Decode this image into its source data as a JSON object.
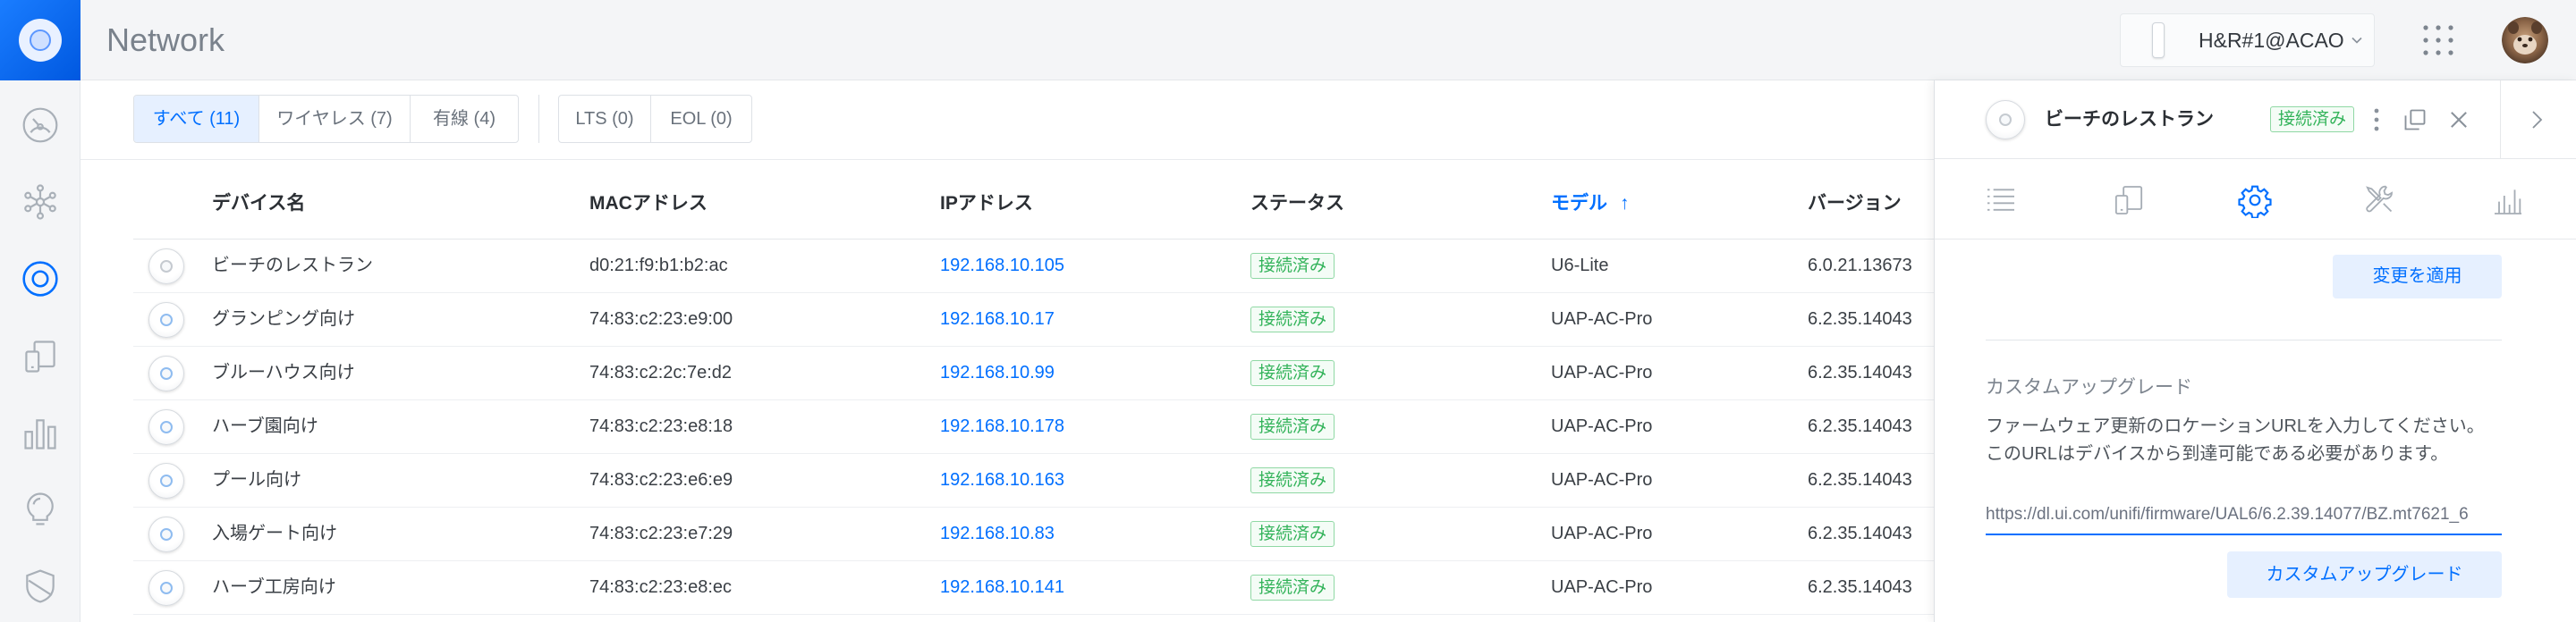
{
  "app": {
    "title": "Network"
  },
  "colors": {
    "accent": "#006fff",
    "connected": "#33b35a",
    "connected_border": "#8fd8a4",
    "muted_icon": "#a9b0b8"
  },
  "sidebar": {
    "logo": "unifi-logo",
    "items": [
      {
        "icon": "dashboard-icon",
        "active": false
      },
      {
        "icon": "topology-icon",
        "active": false
      },
      {
        "icon": "devices-icon",
        "active": true
      },
      {
        "icon": "clients-icon",
        "active": false
      },
      {
        "icon": "statistics-icon",
        "active": false
      },
      {
        "icon": "insights-icon",
        "active": false
      },
      {
        "icon": "shield-icon",
        "active": false
      }
    ]
  },
  "header": {
    "site_selector": {
      "label": "H&R#1@ACAO",
      "icon": "gateway-device-icon",
      "caret": "chevron-down-icon"
    },
    "apps_icon": "grid-icon",
    "avatar": "user-avatar"
  },
  "filters": {
    "device_type": [
      {
        "label": "すべて (11)",
        "active": true
      },
      {
        "label": "ワイヤレス (7)",
        "active": false
      },
      {
        "label": "有線 (4)",
        "active": false
      }
    ],
    "lifecycle": [
      {
        "label": "LTS (0)",
        "active": false
      },
      {
        "label": "EOL (0)",
        "active": false
      }
    ]
  },
  "table": {
    "columns": {
      "name": "デバイス名",
      "mac": "MACアドレス",
      "ip": "IPアドレス",
      "status": "ステータス",
      "model": "モデル",
      "model_sort_indicator": "↑",
      "version": "バージョン"
    },
    "rows": [
      {
        "icon": "access-point-icon",
        "icon_accent": "#c5cad0",
        "name": "ビーチのレストラン",
        "mac": "d0:21:f9:b1:b2:ac",
        "ip": "192.168.10.105",
        "status": "接続済み",
        "model": "U6-Lite",
        "version": "6.0.21.13673"
      },
      {
        "icon": "access-point-icon",
        "icon_accent": "#8fbcf0",
        "name": "グランピング向け",
        "mac": "74:83:c2:23:e9:00",
        "ip": "192.168.10.17",
        "status": "接続済み",
        "model": "UAP-AC-Pro",
        "version": "6.2.35.14043"
      },
      {
        "icon": "access-point-icon",
        "icon_accent": "#8fbcf0",
        "name": "ブルーハウス向け",
        "mac": "74:83:c2:2c:7e:d2",
        "ip": "192.168.10.99",
        "status": "接続済み",
        "model": "UAP-AC-Pro",
        "version": "6.2.35.14043"
      },
      {
        "icon": "access-point-icon",
        "icon_accent": "#8fbcf0",
        "name": "ハーブ園向け",
        "mac": "74:83:c2:23:e8:18",
        "ip": "192.168.10.178",
        "status": "接続済み",
        "model": "UAP-AC-Pro",
        "version": "6.2.35.14043"
      },
      {
        "icon": "access-point-icon",
        "icon_accent": "#8fbcf0",
        "name": "プール向け",
        "mac": "74:83:c2:23:e6:e9",
        "ip": "192.168.10.163",
        "status": "接続済み",
        "model": "UAP-AC-Pro",
        "version": "6.2.35.14043"
      },
      {
        "icon": "access-point-icon",
        "icon_accent": "#8fbcf0",
        "name": "入場ゲート向け",
        "mac": "74:83:c2:23:e7:29",
        "ip": "192.168.10.83",
        "status": "接続済み",
        "model": "UAP-AC-Pro",
        "version": "6.2.35.14043"
      },
      {
        "icon": "access-point-icon",
        "icon_accent": "#8fbcf0",
        "name": "ハーブ工房向け",
        "mac": "74:83:c2:23:e8:ec",
        "ip": "192.168.10.141",
        "status": "接続済み",
        "model": "UAP-AC-Pro",
        "version": "6.2.35.14043"
      }
    ]
  },
  "panel": {
    "device": {
      "icon": "access-point-icon",
      "name": "ビーチのレストラン",
      "status": "接続済み"
    },
    "actions": [
      "more-vertical-icon",
      "pop-out-icon",
      "close-icon",
      "chevron-right-icon"
    ],
    "tabs": [
      {
        "icon": "list-icon",
        "active": false
      },
      {
        "icon": "clients-icon",
        "active": false
      },
      {
        "icon": "settings-icon",
        "active": true
      },
      {
        "icon": "tools-icon",
        "active": false
      },
      {
        "icon": "statistics-icon",
        "active": false
      }
    ],
    "apply_button": "変更を適用",
    "custom_upgrade": {
      "title": "カスタムアップグレード",
      "description": "ファームウェア更新のロケーションURLを入力してください。このURLはデバイスから到達可能である必要があります。",
      "url_value": "https://dl.ui.com/unifi/firmware/UAL6/6.2.39.14077/BZ.mt7621_6",
      "button": "カスタムアップグレード"
    }
  }
}
